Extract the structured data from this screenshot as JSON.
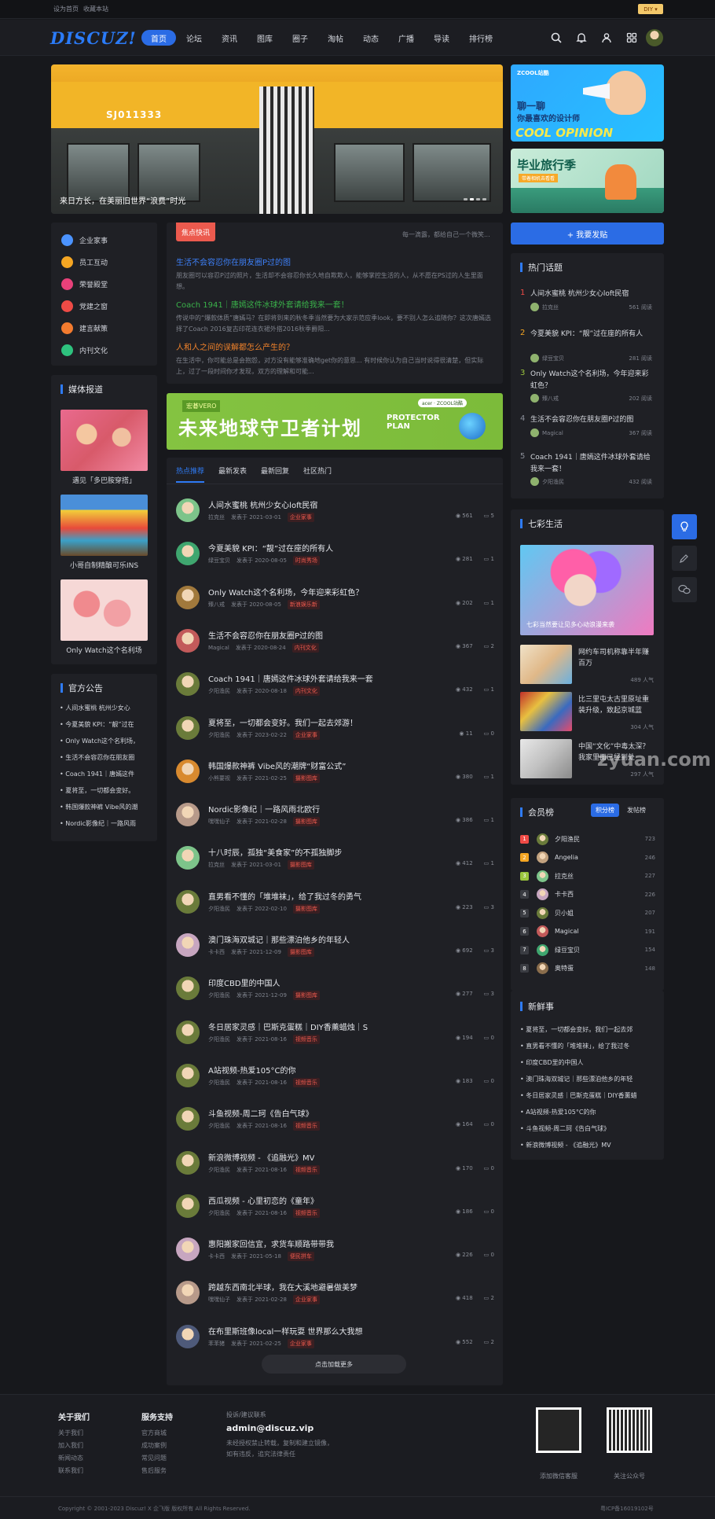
{
  "topbar": {
    "links": [
      "设为首页",
      "收藏本站"
    ],
    "diy": "DIY"
  },
  "nav": {
    "logo": "DISCUZ!",
    "items": [
      "首页",
      "论坛",
      "资讯",
      "图库",
      "圈子",
      "淘帖",
      "动态",
      "广播",
      "导读",
      "排行榜"
    ],
    "active": 0
  },
  "slider": {
    "caption": "来日方长，在美丽旧世界“浪费”时光",
    "code": "SJ011333"
  },
  "ads": {
    "ad1": {
      "brand": "ZCOOL站酷",
      "line1": "聊一聊",
      "line2": "你最喜欢的设计师",
      "line3": "COOL OPINION"
    },
    "ad2": {
      "line1": "毕业旅行季",
      "line2": "带着相机去看看"
    }
  },
  "categories": [
    {
      "label": "企业家事",
      "color": "#4b93ff"
    },
    {
      "label": "员工互动",
      "color": "#f5a623"
    },
    {
      "label": "荣誉殿堂",
      "color": "#e8417a"
    },
    {
      "label": "党建之窗",
      "color": "#ef4b46"
    },
    {
      "label": "建言献策",
      "color": "#f37b2f"
    },
    {
      "label": "内刊文化",
      "color": "#2ec27e"
    }
  ],
  "flash": {
    "tag": "焦点快讯",
    "hint": "每一滴露，都给自己一个微笑...",
    "items": [
      {
        "title": "生活不会容忍你在朋友圈P过的图",
        "color": "#3d7ff6",
        "desc": "朋友圈可以容忍P过的照片，生活却不会容忍你长久地自欺欺人，能够掌控生活的人，从不愿在PS过的人生里面想。"
      },
      {
        "title": "Coach 1941｜唐嫣这件冰球外套请给我来一套！",
        "color": "#3ab24a",
        "desc": "传说中的“爆款体质”唐嫣马？在即将到来的秋冬季当然要为大家示范应季look，要不别人怎么追随你？这次唐嫣选择了Coach 2016复古印花连衣裙外搭2016秋季爵阳..."
      },
      {
        "title": "人和人之间的误解都怎么产生的？",
        "color": "#f0822b",
        "desc": "在生活中，你可能总是会抱怨，对方没有能够准确地get你的意思... 有时候你认为自己当时说得很清楚，但实际上，过了一段时间你才发现，双方的理解和可能..."
      }
    ]
  },
  "banner": {
    "small": "宏碁VERO",
    "title": "未来地球守卫者计划",
    "plan": "PROTECTOR PLAN",
    "brand": "acer · ZCOOL站酷"
  },
  "threadTabs": [
    "热点推荐",
    "最新发表",
    "最新回复",
    "社区热门"
  ],
  "threads": [
    {
      "title": "人间水蜜桃 杭州少女心loft民宿",
      "author": "拉克丝",
      "date": "发表于 2021-03-01",
      "forum": "企业家事",
      "views": "561",
      "replies": "5",
      "av": "#7dc48a"
    },
    {
      "title": "今夏美貌 KPI：“靓”过在座的所有人",
      "author": "绿豆宝贝",
      "date": "发表于 2020-08-05",
      "forum": "时尚秀场",
      "views": "281",
      "replies": "1",
      "av": "#3fa66f"
    },
    {
      "title": "Only Watch这个名利场，今年迎来彩虹色？",
      "author": "臻八戒",
      "date": "发表于 2020-08-05",
      "forum": "新浪娱乐新",
      "views": "202",
      "replies": "1",
      "av": "#a1793c"
    },
    {
      "title": "生活不会容忍你在朋友圈P过的图",
      "author": "Magical",
      "date": "发表于 2020-08-24",
      "forum": "内刊文化",
      "views": "367",
      "replies": "2",
      "av": "#c25a5a"
    },
    {
      "title": "Coach 1941｜唐嫣这件冰球外套请给我来一套",
      "author": "夕阳渔民",
      "date": "发表于 2020-08-18",
      "forum": "内刊文化",
      "views": "432",
      "replies": "1",
      "av": "#6a7b3a"
    },
    {
      "title": "夏将至，一切都会变好。我们一起去郊游！",
      "author": "夕阳渔民",
      "date": "发表于 2023-02-22",
      "forum": "企业家事",
      "views": "11",
      "replies": "0",
      "av": "#6a7b3a"
    },
    {
      "title": "韩国爆款神裤 Vibe风的潮牌“财富公式”",
      "author": "小熊要视",
      "date": "发表于 2021-02-25",
      "forum": "摄影图库",
      "views": "380",
      "replies": "1",
      "av": "#d88a2f"
    },
    {
      "title": "Nordic影像纪｜一路风雨北欧行",
      "author": "嘿嘿仙子",
      "date": "发表于 2021-02-28",
      "forum": "摄影图库",
      "views": "386",
      "replies": "1",
      "av": "#b79a8a"
    },
    {
      "title": "十八时辰，孤独“美食家”的不孤独脚步",
      "author": "拉克丝",
      "date": "发表于 2021-03-01",
      "forum": "摄影图库",
      "views": "412",
      "replies": "1",
      "av": "#7dc48a"
    },
    {
      "title": "直男看不懂的「堆堆袜」，给了我过冬的勇气",
      "author": "夕阳渔民",
      "date": "发表于 2022-02-10",
      "forum": "摄影图库",
      "views": "223",
      "replies": "3",
      "av": "#6a7b3a"
    },
    {
      "title": "澳门珠海双城记｜那些漂泊他乡的年轻人",
      "author": "卡卡西",
      "date": "发表于 2021-12-09",
      "forum": "摄影图库",
      "views": "692",
      "replies": "3",
      "av": "#c7a6c0"
    },
    {
      "title": "印度CBD里的中国人",
      "author": "夕阳渔民",
      "date": "发表于 2021-12-09",
      "forum": "摄影图库",
      "views": "277",
      "replies": "3",
      "av": "#6a7b3a"
    },
    {
      "title": "冬日居家灵感｜巴斯克蛋糕｜DIY香薰蜡烛｜S",
      "author": "夕阳渔民",
      "date": "发表于 2021-08-16",
      "forum": "视频音乐",
      "views": "194",
      "replies": "0",
      "av": "#6a7b3a"
    },
    {
      "title": "A站视频-热爱105°C的你",
      "author": "夕阳渔民",
      "date": "发表于 2021-08-16",
      "forum": "视频音乐",
      "views": "183",
      "replies": "0",
      "av": "#6a7b3a"
    },
    {
      "title": "斗鱼视频-周二珂《告白气球》",
      "author": "夕阳渔民",
      "date": "发表于 2021-08-16",
      "forum": "视频音乐",
      "views": "164",
      "replies": "0",
      "av": "#6a7b3a"
    },
    {
      "title": "新浪微博视频 - 《追融光》MV",
      "author": "夕阳渔民",
      "date": "发表于 2021-08-16",
      "forum": "视频音乐",
      "views": "170",
      "replies": "0",
      "av": "#6a7b3a"
    },
    {
      "title": "西瓜视频 - 心里初恋的《童年》",
      "author": "夕阳渔民",
      "date": "发表于 2021-08-16",
      "forum": "视频音乐",
      "views": "186",
      "replies": "0",
      "av": "#6a7b3a"
    },
    {
      "title": "惠阳搬家回信宜，求货车顺路带带我",
      "author": "卡卡西",
      "date": "发表于 2021-05-18",
      "forum": "便民拼车",
      "views": "226",
      "replies": "0",
      "av": "#c7a6c0"
    },
    {
      "title": "跨越东西南北半球，我在大溪地避暑做美梦",
      "author": "嘿嘿仙子",
      "date": "发表于 2021-02-28",
      "forum": "企业家事",
      "views": "418",
      "replies": "2",
      "av": "#b79a8a"
    },
    {
      "title": "在布里斯班像local一样玩耍 世界那么大我想",
      "author": "苯苯猪",
      "date": "发表于 2021-02-25",
      "forum": "企业家事",
      "views": "552",
      "replies": "2",
      "av": "#4e5a7a"
    }
  ],
  "loadMore": "点击加载更多",
  "media": {
    "title": "媒体报道",
    "items": [
      "遇见「多巴胺穿搭」",
      "小哥自制精酿可乐INS",
      "Only Watch这个名利场"
    ]
  },
  "notice": {
    "title": "官方公告",
    "items": [
      "人间水蜜桃 杭州少女心",
      "今夏美貌 KPI：“靓”过在",
      "Only Watch这个名利场，",
      "生活不会容忍你在朋友圈",
      "Coach 1941｜唐嫣这件",
      "夏将至，一切都会变好。",
      "韩国爆款神裤 Vibe风的潮",
      "Nordic影像纪｜一路风雨"
    ]
  },
  "postButton": "+ 我要发贴",
  "hot": {
    "title": "热门话题",
    "items": [
      {
        "n": "1",
        "title": "人间水蜜桃 杭州少女心loft民宿",
        "user": "拉克丝",
        "reads": "561 阅读",
        "color": "#ef4b46"
      },
      {
        "n": "2",
        "title": "今夏美貌 KPI：“靓”过在座的所有人",
        "user": "绿豆宝贝",
        "reads": "281 阅读",
        "color": "#f5a623"
      },
      {
        "n": "3",
        "title": "Only Watch这个名利场，今年迎来彩虹色？",
        "user": "臻八戒",
        "reads": "202 阅读",
        "color": "#9bc53d"
      },
      {
        "n": "4",
        "title": "生活不会容忍你在朋友圈P过的图",
        "user": "Magical",
        "reads": "367 阅读",
        "color": "#8a8e98"
      },
      {
        "n": "5",
        "title": "Coach 1941｜唐嫣这件冰球外套请给我来一套！",
        "user": "夕阳渔民",
        "reads": "432 阅读",
        "color": "#8a8e98"
      }
    ]
  },
  "life": {
    "title": "七彩生活",
    "feature": "七彩当然要让见多心动浪漫来袭",
    "items": [
      {
        "title": "网约车司机称靠半年赚百万",
        "meta": "489 人气"
      },
      {
        "title": "比三里屯太古里原址重装升级，致起京城蓝",
        "meta": "304 人气"
      },
      {
        "title": "中国“文化”中毒太深？我家里面已经到处",
        "meta": "297 人气"
      }
    ]
  },
  "rank": {
    "title": "会员榜",
    "tabs": [
      "积分榜",
      "发帖榜"
    ],
    "items": [
      {
        "n": "1",
        "name": "夕阳渔民",
        "v": "723",
        "color": "#ef4b46",
        "av": "#6a7b3a"
      },
      {
        "n": "2",
        "name": "Angelia",
        "v": "246",
        "color": "#f5a623",
        "av": "#c2a27f"
      },
      {
        "n": "3",
        "name": "拉克丝",
        "v": "227",
        "color": "#9bc53d",
        "av": "#7dc48a"
      },
      {
        "n": "4",
        "name": "卡卡西",
        "v": "226",
        "color": "#3a3c42",
        "av": "#c7a6c0"
      },
      {
        "n": "5",
        "name": "贝小姐",
        "v": "207",
        "color": "#3a3c42",
        "av": "#6a7b3a"
      },
      {
        "n": "6",
        "name": "Magical",
        "v": "191",
        "color": "#3a3c42",
        "av": "#c25a5a"
      },
      {
        "n": "7",
        "name": "绿豆宝贝",
        "v": "154",
        "color": "#3a3c42",
        "av": "#3fa66f"
      },
      {
        "n": "8",
        "name": "奥特蛋",
        "v": "148",
        "color": "#3a3c42",
        "av": "#8a6d4c"
      }
    ]
  },
  "fresh": {
    "title": "新鲜事",
    "items": [
      "夏将至，一切都会变好。我们一起去郊",
      "直男看不懂的「堆堆袜」，给了我过冬",
      "印度CBD里的中国人",
      "澳门珠海双城记｜那些漂泊他乡的年轻",
      "冬日居家灵感｜巴斯克蛋糕｜DIY香薰蜡",
      "A站视频-热爱105°C的你",
      "斗鱼视频-周二珂《告白气球》",
      "新浪微博视频 - 《追融光》MV"
    ]
  },
  "footer": {
    "about": {
      "title": "关于我们",
      "links": [
        "关于我们",
        "加入我们",
        "新闻动态",
        "联系我们"
      ]
    },
    "support": {
      "title": "服务支持",
      "links": [
        "官方商城",
        "成功案例",
        "常见问题",
        "售后服务"
      ]
    },
    "contact": {
      "label": "投诉/建议联系",
      "email": "admin@discuz.vip",
      "note1": "未经授权禁止转载，复制和建立镜像，",
      "note2": "如有违反，追究法律责任"
    },
    "qr1": "添加微信客服",
    "qr2": "关注公众号",
    "copyright": "Copyright © 2001-2023 Discuz! X 企飞版 版权所有 All Rights Reserved.",
    "icp": "粤ICP备16019102号"
  },
  "watermark": "zyuan.com"
}
